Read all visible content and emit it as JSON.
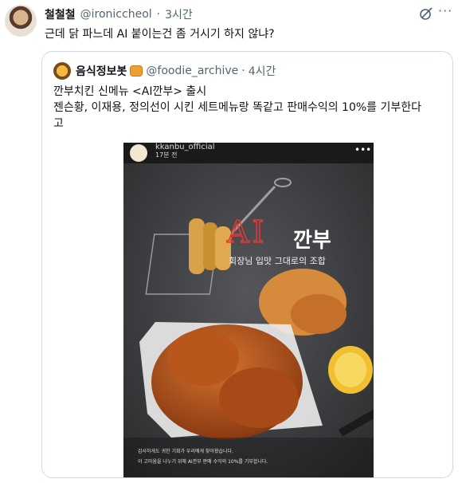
{
  "tweet": {
    "display_name": "철철철",
    "handle": "@ironiccheol",
    "separator": "·",
    "time": "3시간",
    "text": "근데 닭 파느데 AI 붙이는건 좀 거시기 하지 않냐?"
  },
  "quote": {
    "display_name": "음식정보봇",
    "handle": "@foodie_archive",
    "separator": "·",
    "time": "4시간",
    "lines": [
      "깐부치킨 신메뉴 <AI깐부> 출시",
      "젠슨황, 이재용, 정의선이 시킨 세트메뉴랑 똑같고 판매수익의 10%를 기부한다",
      "고"
    ],
    "media": {
      "username": "kkanbu_official",
      "posted": "17분 전",
      "headline_ai": "AI",
      "headline_brand": "깐부",
      "tagline": "회장님 입맛 그대로의 조합",
      "caption_1": "감사하게도 귀한 기회가 우리에게 찾아왔습니다.",
      "caption_2": "이 고마움을 나누기 위해 AI깐부 판매 수익의 10%를 기부합니다."
    }
  },
  "icons": [
    "grok-icon",
    "more-icon",
    "pancake-emoji-icon"
  ],
  "colors": {
    "text": "#0f1419",
    "secondary": "#536471",
    "border": "#cfd9de",
    "ai_red": "#e53935"
  }
}
